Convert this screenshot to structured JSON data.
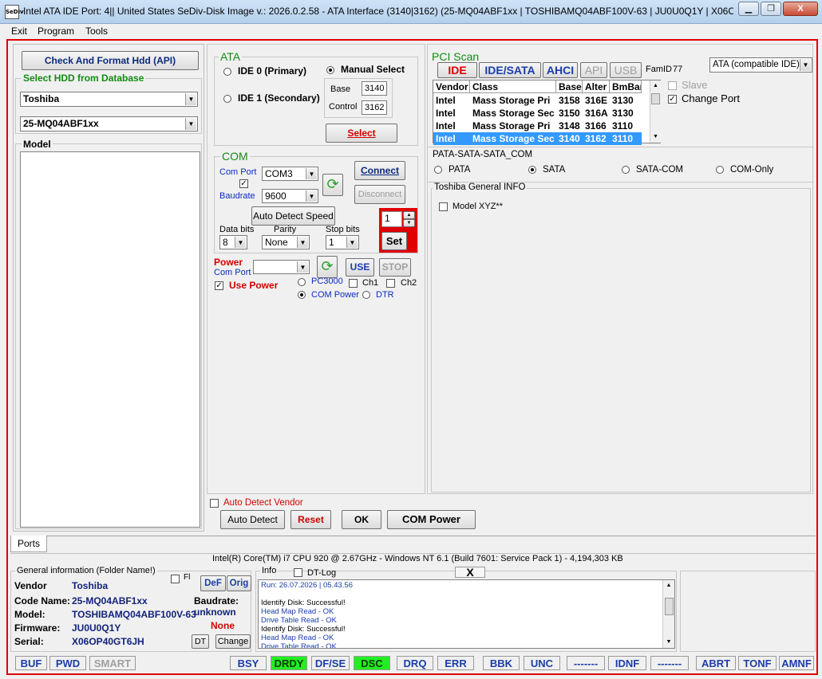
{
  "window": {
    "icon_text": "SeDiv",
    "title": "Intel ATA IDE  Port: 4|| United States  SeDiv-Disk Image v.: 2026.0.2.58 - ATA Interface (3140|3162)  (25-MQ04ABF1xx | TOSHIBAMQ04ABF100V-63 | JU0U0Q1Y | X06O...",
    "min_glyph": "▁",
    "max_glyph": "❐",
    "close_glyph": "X"
  },
  "menu": [
    "Exit",
    "Program",
    "Tools"
  ],
  "left": {
    "check_format_label": "Check And Format Hdd (API)",
    "select_db_title": "Select HDD from Database",
    "vendor_value": "Toshiba",
    "family_value": "25-MQ04ABF1xx",
    "model_title": "Model"
  },
  "ata": {
    "title": "ATA",
    "ide0": "IDE 0 (Primary)",
    "ide1": "IDE 1 (Secondary)",
    "manual": "Manual Select",
    "base_label": "Base",
    "base_value": "3140",
    "control_label": "Control",
    "control_value": "3162",
    "select_label": "Select"
  },
  "com": {
    "title": "COM",
    "com_port_label": "Com Port",
    "com_port_value": "COM3",
    "baudrate_label": "Baudrate",
    "baudrate_value": "9600",
    "connect_label": "Connect",
    "disconnect_label": "Disconnect",
    "auto_detect_speed": "Auto Detect Speed",
    "data_bits_label": "Data bits",
    "data_bits_value": "8",
    "parity_label": "Parity",
    "parity_value": "None",
    "stop_bits_label": "Stop bits",
    "stop_bits_value": "1",
    "spin_value": "1",
    "set_label": "Set",
    "power_label": "Power",
    "power_com_port_label": "Com Port",
    "use_label": "USE",
    "stop_label": "STOP",
    "use_power_label": "Use Power",
    "pc3000_label": "PC3000",
    "ch1_label": "Ch1",
    "ch2_label": "Ch2",
    "com_power_label": "COM Power",
    "dtr_label": "DTR"
  },
  "pci": {
    "title": "PCI Scan",
    "tabs": [
      "IDE",
      "IDE/SATA",
      "AHCI",
      "API",
      "USB"
    ],
    "famid_label": "FamID",
    "famid_value": "77",
    "mode_value": "ATA (compatible IDE)",
    "slave_label": "Slave",
    "change_port_label": "Change Port",
    "columns": [
      "Vendor",
      "Class",
      "Base",
      "Alter",
      "BmBar"
    ],
    "rows": [
      [
        "Intel",
        "Mass Storage Pri",
        "3158",
        "316E",
        "3130"
      ],
      [
        "Intel",
        "Mass Storage Sec",
        "3150",
        "316A",
        "3130"
      ],
      [
        "Intel",
        "Mass Storage Pri",
        "3148",
        "3166",
        "3110"
      ],
      [
        "Intel",
        "Mass Storage Sec",
        "3140",
        "3162",
        "3110"
      ]
    ]
  },
  "iface": {
    "title": "PATA-SATA-SATA_COM",
    "options": [
      "PATA",
      "SATA",
      "SATA-COM",
      "COM-Only"
    ]
  },
  "general_info": {
    "title": "Toshiba General INFO",
    "model_xyz": "Model XYZ**"
  },
  "bottom_controls": {
    "auto_detect_vendor": "Auto Detect Vendor",
    "auto_detect": "Auto Detect",
    "reset": "Reset",
    "ok": "OK",
    "com_power": "COM Power"
  },
  "ports_tab": "Ports",
  "system_info": "Intel(R) Core(TM) i7 CPU 920  @ 2.67GHz - Windows NT 6.1 (Build 7601: Service Pack 1) -  4,194,303 KB",
  "general": {
    "title": "General information (Folder Name!)",
    "fl_label": "Fl",
    "def_label": "DeF",
    "orig_label": "Orig",
    "vendor_label": "Vendor",
    "vendor_value": "Toshiba",
    "code_label": "Code Name:",
    "code_value": "25-MQ04ABF1xx",
    "model_label": "Model:",
    "model_value": "TOSHIBAMQ04ABF100V-63",
    "firmware_label": "Firmware:",
    "firmware_value": "JU0U0Q1Y",
    "serial_label": "Serial:",
    "serial_value": "X06OP40GT6JH",
    "baudrate_label": "Baudrate:",
    "baudrate_value": "unknown",
    "none_value": "None",
    "dt_label": "DT",
    "change_label": "Change"
  },
  "info": {
    "title": "Info",
    "dtlog_label": "DT-Log",
    "close_glyph": "X",
    "lines": [
      "Run: 26.07.2026  |  05.43.56",
      "",
      "Identify Disk: Successful!",
      "Head Map Read - OK",
      "Drive Table Read - OK",
      "Identify Disk: Successful!",
      "Head Map Read - OK",
      "Drive Table Read - OK"
    ]
  },
  "status": [
    {
      "label": "BUF",
      "state": "normal"
    },
    {
      "label": "PWD",
      "state": "normal"
    },
    {
      "label": "SMART",
      "state": "dim"
    },
    {
      "label": "BSY",
      "state": "normal"
    },
    {
      "label": "DRDY",
      "state": "on"
    },
    {
      "label": "DF/SE",
      "state": "normal"
    },
    {
      "label": "DSC",
      "state": "on"
    },
    {
      "label": "DRQ",
      "state": "normal"
    },
    {
      "label": "ERR",
      "state": "normal"
    },
    {
      "label": "BBK",
      "state": "normal"
    },
    {
      "label": "UNC",
      "state": "normal"
    },
    {
      "label": "-------",
      "state": "normal"
    },
    {
      "label": "IDNF",
      "state": "normal"
    },
    {
      "label": "-------",
      "state": "normal"
    },
    {
      "label": "ABRT",
      "state": "normal"
    },
    {
      "label": "TONF",
      "state": "normal"
    },
    {
      "label": "AMNF",
      "state": "normal"
    }
  ],
  "colors": {
    "accent_red": "#e00000",
    "status_on": "#22ee22",
    "selection": "#3399ff"
  }
}
